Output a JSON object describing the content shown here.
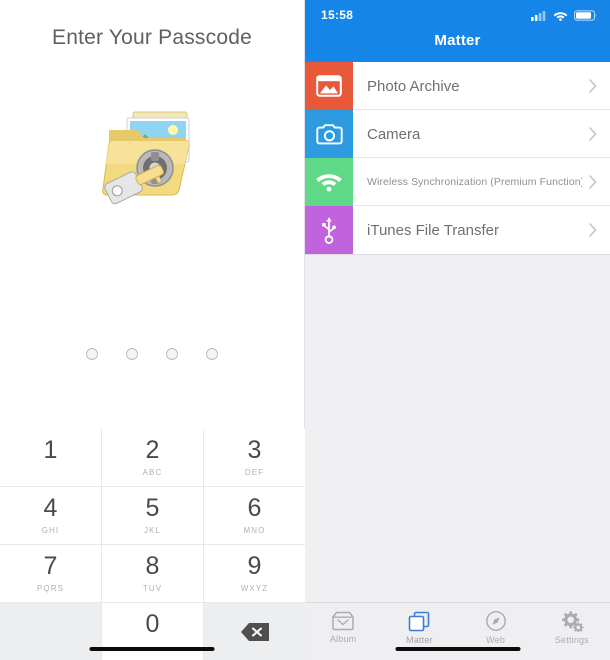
{
  "passcode": {
    "title": "Enter Your Passcode",
    "art_icon": "locked-folder-icon",
    "dots": [
      {
        "filled": false
      },
      {
        "filled": false
      },
      {
        "filled": false
      },
      {
        "filled": false
      }
    ],
    "keys": [
      {
        "num": "1",
        "letters": ""
      },
      {
        "num": "2",
        "letters": "ABC"
      },
      {
        "num": "3",
        "letters": "DEF"
      },
      {
        "num": "4",
        "letters": "GHI"
      },
      {
        "num": "5",
        "letters": "JKL"
      },
      {
        "num": "6",
        "letters": "MNO"
      },
      {
        "num": "7",
        "letters": "PQRS"
      },
      {
        "num": "8",
        "letters": "TUV"
      },
      {
        "num": "9",
        "letters": "WXYZ"
      },
      {
        "num": "",
        "letters": ""
      },
      {
        "num": "0",
        "letters": ""
      },
      {
        "num": "",
        "letters": "",
        "icon": "backspace-icon"
      }
    ]
  },
  "app": {
    "status_bar": {
      "time": "15:58",
      "icons": [
        "cellular-signal-icon",
        "wifi-icon",
        "battery-icon"
      ]
    },
    "nav": {
      "title": "Matter"
    },
    "list": [
      {
        "label": "Photo Archive",
        "icon": "photo-archive-icon",
        "color": "#E8593A",
        "small": false
      },
      {
        "label": "Camera",
        "icon": "camera-icon",
        "color": "#2E9BE0",
        "small": false
      },
      {
        "label": "Wireless Synchronization (Premium Function)",
        "icon": "wifi-sync-icon",
        "color": "#5FD887",
        "small": true
      },
      {
        "label": "iTunes File Transfer",
        "icon": "usb-icon",
        "color": "#C063DC",
        "small": false
      }
    ],
    "tabs": [
      {
        "label": "Album",
        "icon": "album-tray-icon",
        "active": false
      },
      {
        "label": "Matter",
        "icon": "matter-stack-icon",
        "active": true
      },
      {
        "label": "Web",
        "icon": "compass-icon",
        "active": false
      },
      {
        "label": "Settings",
        "icon": "gear-icon",
        "active": false
      }
    ],
    "colors": {
      "accent": "#1586e8",
      "tab_active": "#3a7fd5",
      "tab_inactive": "#a9adb2"
    }
  }
}
